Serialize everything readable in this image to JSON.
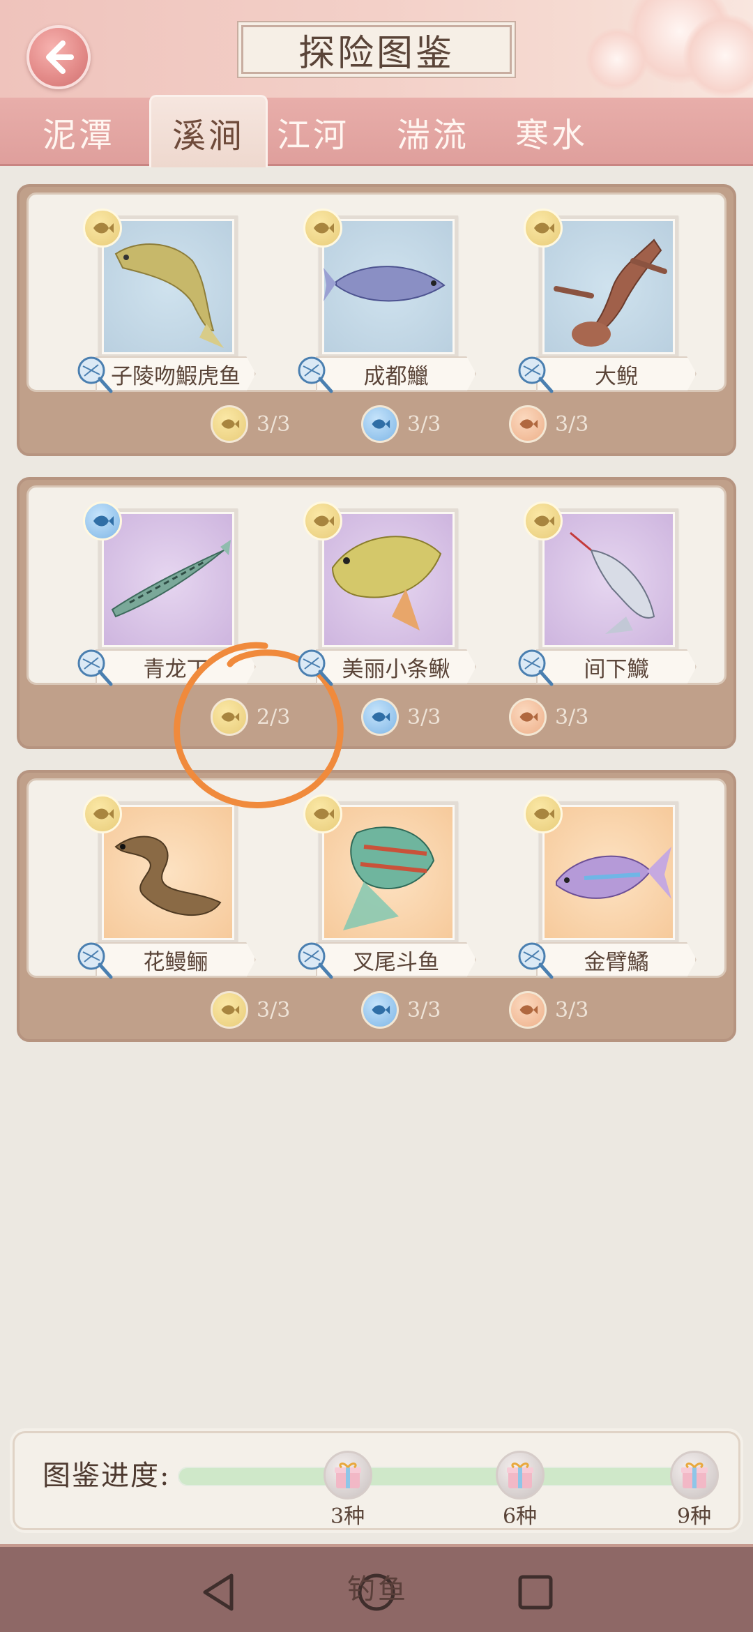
{
  "header": {
    "title": "探险图鉴",
    "back_label": "back"
  },
  "tabs": [
    {
      "label": "泥潭",
      "active": false
    },
    {
      "label": "溪涧",
      "active": true
    },
    {
      "label": "江河",
      "active": false
    },
    {
      "label": "湍流",
      "active": false
    },
    {
      "label": "寒水",
      "active": false
    }
  ],
  "groups": [
    {
      "bg": "blue",
      "fish": [
        {
          "name": "子陵吻鰕虎鱼",
          "badge": "gold"
        },
        {
          "name": "成都鱲",
          "badge": "gold"
        },
        {
          "name": "大鲵",
          "badge": "gold"
        }
      ],
      "progress": [
        {
          "tier": "gold",
          "value": "3/3"
        },
        {
          "tier": "blue",
          "value": "3/3"
        },
        {
          "tier": "peach",
          "value": "3/3"
        }
      ]
    },
    {
      "bg": "purple",
      "fish": [
        {
          "name": "青龙丁",
          "badge": "blue"
        },
        {
          "name": "美丽小条鳅",
          "badge": "gold"
        },
        {
          "name": "间下鱵",
          "badge": "gold"
        }
      ],
      "progress": [
        {
          "tier": "gold",
          "value": "2/3"
        },
        {
          "tier": "blue",
          "value": "3/3"
        },
        {
          "tier": "peach",
          "value": "3/3"
        }
      ]
    },
    {
      "bg": "orange",
      "fish": [
        {
          "name": "花鳗鲡",
          "badge": "gold"
        },
        {
          "name": "叉尾斗鱼",
          "badge": "gold"
        },
        {
          "name": "金臂鱊",
          "badge": "gold"
        }
      ],
      "progress": [
        {
          "tier": "gold",
          "value": "3/3"
        },
        {
          "tier": "blue",
          "value": "3/3"
        },
        {
          "tier": "peach",
          "value": "3/3"
        }
      ]
    }
  ],
  "collection": {
    "label": "图鉴进度:",
    "milestones": [
      "3种",
      "6种",
      "9种"
    ],
    "progress_fraction": 1.0
  },
  "system_nav": {
    "overlay_text": "钓鱼"
  },
  "colors": {
    "annotation": "#f08a3c",
    "tab_bar": "#e3a6a3",
    "card_border": "#c0a08a"
  }
}
